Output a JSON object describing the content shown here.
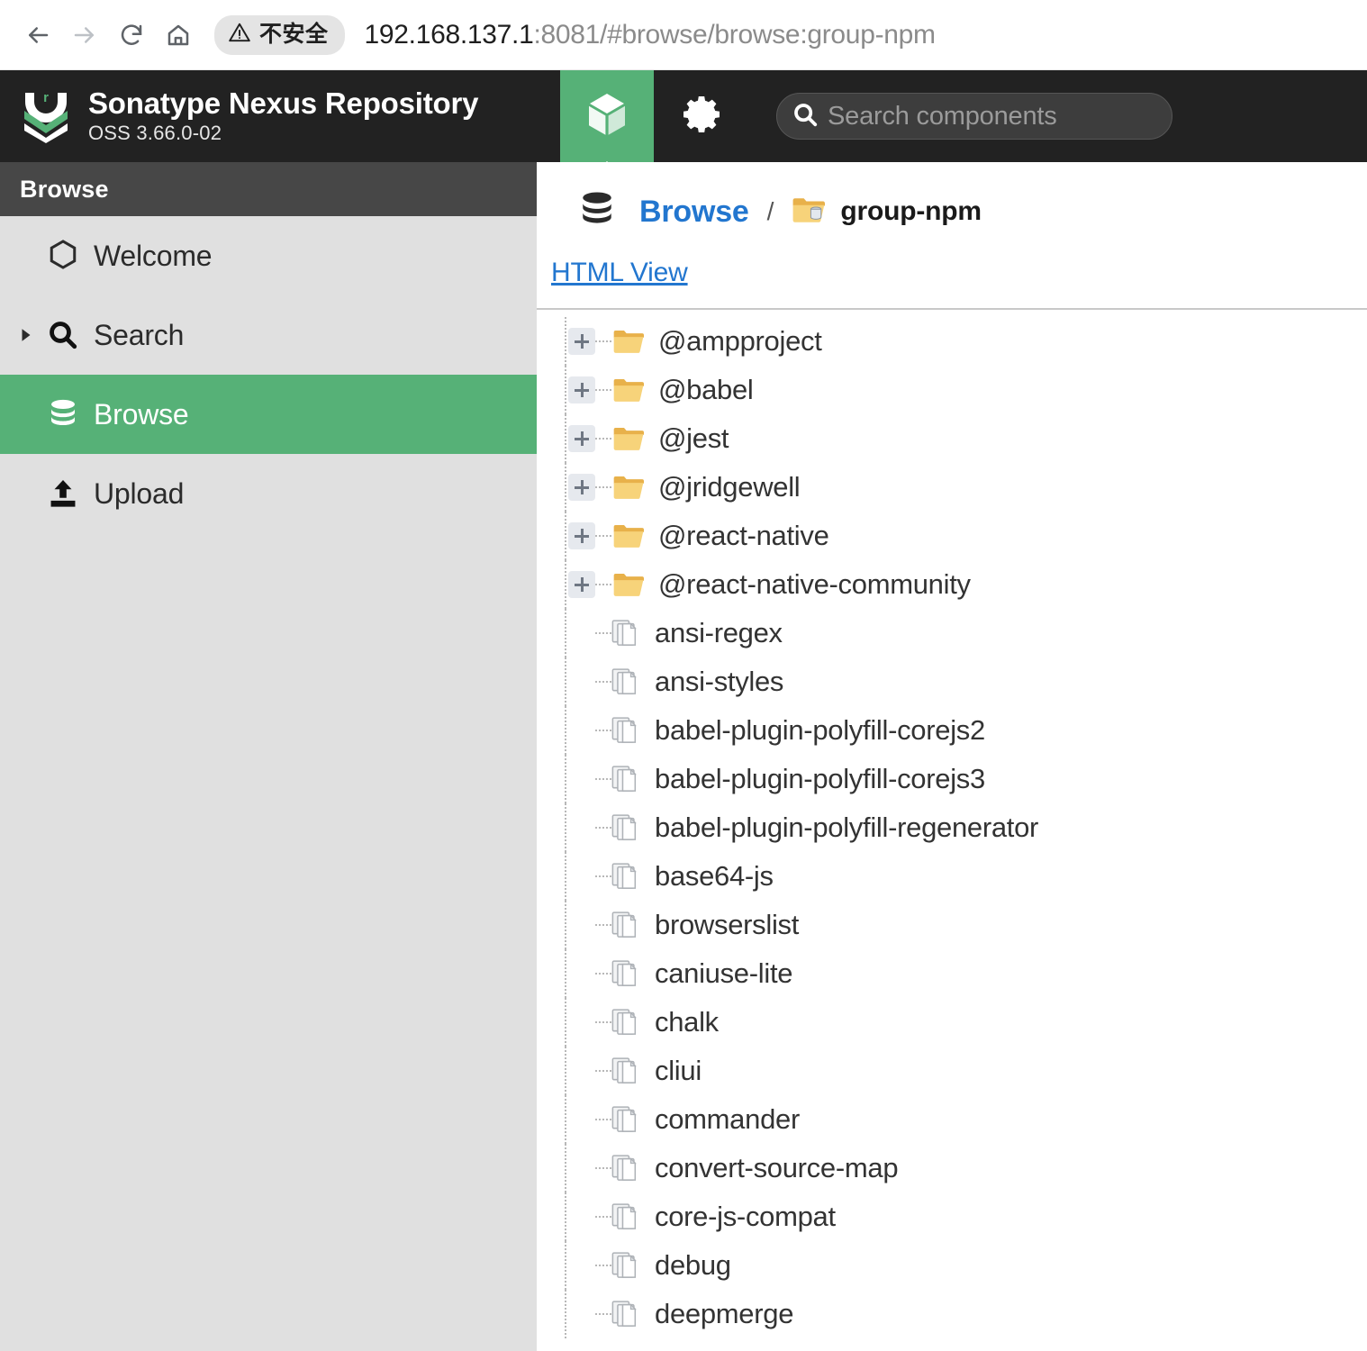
{
  "browser": {
    "back_icon": "arrow-left-icon",
    "forward_icon": "arrow-right-icon",
    "reload_icon": "reload-icon",
    "home_icon": "home-icon",
    "security_badge": {
      "icon": "warning-triangle-icon",
      "label": "不安全"
    },
    "url": {
      "host": "192.168.137.1",
      "rest": ":8081/#browse/browse:group-npm",
      "full": "192.168.137.1:8081/#browse/browse:group-npm"
    }
  },
  "header": {
    "logo_icon": "nexus-chevron-logo",
    "title": "Sonatype Nexus Repository",
    "version": "OSS 3.66.0-02",
    "tabs": [
      {
        "name": "browse-tab",
        "icon": "cube-icon",
        "active": true
      },
      {
        "name": "admin-tab",
        "icon": "gear-icon",
        "active": false
      }
    ],
    "search": {
      "icon": "search-icon",
      "placeholder": "Search components",
      "value": ""
    },
    "colors": {
      "bar": "#222222",
      "accent": "#56b177"
    }
  },
  "sidebar": {
    "header_title": "Browse",
    "items": [
      {
        "label": "Welcome",
        "icon": "hexagon-icon",
        "active": false,
        "expandable": false
      },
      {
        "label": "Search",
        "icon": "search-icon",
        "active": false,
        "expandable": true
      },
      {
        "label": "Browse",
        "icon": "database-icon",
        "active": true,
        "expandable": false
      },
      {
        "label": "Upload",
        "icon": "upload-icon",
        "active": false,
        "expandable": false
      }
    ]
  },
  "main": {
    "breadcrumb": {
      "root_icon": "database-icon",
      "root_label": "Browse",
      "separator": "/",
      "current_icon": "repository-folder-icon",
      "current_label": "group-npm"
    },
    "html_view_link": "HTML View",
    "tree": [
      {
        "label": "@ampproject",
        "type": "folder",
        "expandable": true
      },
      {
        "label": "@babel",
        "type": "folder",
        "expandable": true
      },
      {
        "label": "@jest",
        "type": "folder",
        "expandable": true
      },
      {
        "label": "@jridgewell",
        "type": "folder",
        "expandable": true
      },
      {
        "label": "@react-native",
        "type": "folder",
        "expandable": true
      },
      {
        "label": "@react-native-community",
        "type": "folder",
        "expandable": true
      },
      {
        "label": "ansi-regex",
        "type": "component",
        "expandable": false
      },
      {
        "label": "ansi-styles",
        "type": "component",
        "expandable": false
      },
      {
        "label": "babel-plugin-polyfill-corejs2",
        "type": "component",
        "expandable": false
      },
      {
        "label": "babel-plugin-polyfill-corejs3",
        "type": "component",
        "expandable": false
      },
      {
        "label": "babel-plugin-polyfill-regenerator",
        "type": "component",
        "expandable": false
      },
      {
        "label": "base64-js",
        "type": "component",
        "expandable": false
      },
      {
        "label": "browserslist",
        "type": "component",
        "expandable": false
      },
      {
        "label": "caniuse-lite",
        "type": "component",
        "expandable": false
      },
      {
        "label": "chalk",
        "type": "component",
        "expandable": false
      },
      {
        "label": "cliui",
        "type": "component",
        "expandable": false
      },
      {
        "label": "commander",
        "type": "component",
        "expandable": false
      },
      {
        "label": "convert-source-map",
        "type": "component",
        "expandable": false
      },
      {
        "label": "core-js-compat",
        "type": "component",
        "expandable": false
      },
      {
        "label": "debug",
        "type": "component",
        "expandable": false
      },
      {
        "label": "deepmerge",
        "type": "component",
        "expandable": false
      }
    ]
  }
}
